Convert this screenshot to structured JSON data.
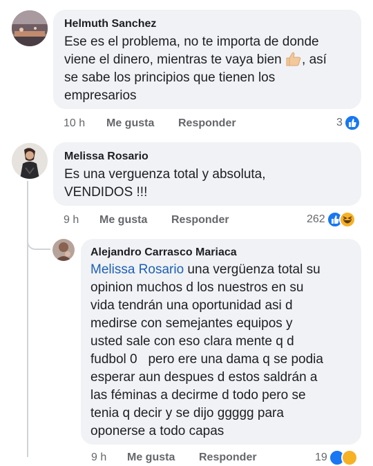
{
  "comments": [
    {
      "author": "Helmuth Sanchez",
      "lines": [
        "Ese es el problema, no te importa de donde",
        "viene el dinero, mientras te vaya bien",
        ", así",
        "se sabe los principios que tienen los",
        "empresarios"
      ],
      "time": "10 h",
      "like_label": "Me gusta",
      "reply_label": "Responder",
      "reaction_count": "3"
    },
    {
      "author": "Melissa Rosario",
      "lines": [
        "Es una verguenza total y absoluta,",
        "VENDIDOS !!!"
      ],
      "time": "9 h",
      "like_label": "Me gusta",
      "reply_label": "Responder",
      "reaction_count": "262"
    },
    {
      "author": "Alejandro Carrasco Mariaca",
      "mention": "Melissa Rosario",
      "lines": [
        " una vergüenza total su",
        "opinion muchos d los nuestros en su",
        "vida tendrán una oportunidad asi d",
        "medirse con semejantes equipos y",
        "usted sale con eso clara mente q d",
        "fudbol 0   pero ere una dama q se podia",
        "esperar aun despues d estos saldrán a",
        "las féminas a decirme d todo pero se",
        "tenia q decir y se dijo ggggg para",
        "oponerse a todo capas"
      ],
      "time": "9 h",
      "like_label": "Me gusta",
      "reply_label": "Responder",
      "reaction_count": "19"
    }
  ],
  "icons": {
    "like": "like-reaction-icon",
    "haha": "haha-reaction-icon",
    "thumb": "thumbs-up-emoji"
  },
  "colors": {
    "bubble": "#f0f2f5",
    "mention": "#1d5fb5",
    "like": "#1877f2",
    "haha": "#f7b125",
    "meta": "#65676b"
  }
}
